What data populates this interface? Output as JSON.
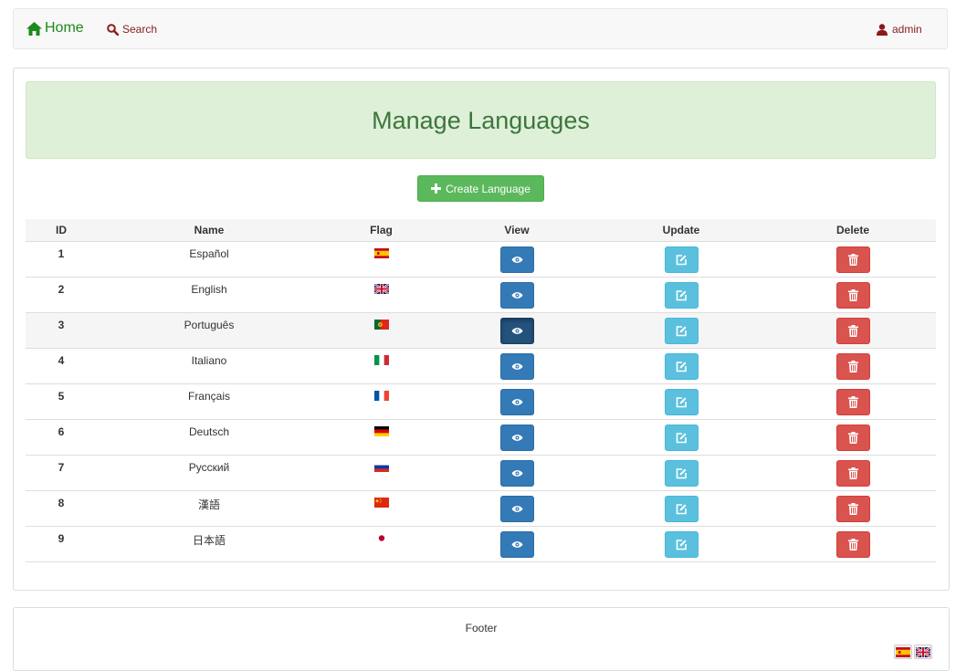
{
  "nav": {
    "home_label": "Home",
    "search_label": "Search",
    "user_label": "admin"
  },
  "page": {
    "title": "Manage Languages",
    "create_label": "Create Language"
  },
  "table": {
    "headers": [
      "ID",
      "Name",
      "Flag",
      "View",
      "Update",
      "Delete"
    ],
    "rows": [
      {
        "id": "1",
        "name": "Español",
        "flag": "es-flag-icon"
      },
      {
        "id": "2",
        "name": "English",
        "flag": "gb-flag-icon"
      },
      {
        "id": "3",
        "name": "Português",
        "flag": "pt-flag-icon"
      },
      {
        "id": "4",
        "name": "Italiano",
        "flag": "it-flag-icon"
      },
      {
        "id": "5",
        "name": "Français",
        "flag": "fr-flag-icon"
      },
      {
        "id": "6",
        "name": "Deutsch",
        "flag": "de-flag-icon"
      },
      {
        "id": "7",
        "name": "Русский",
        "flag": "ru-flag-icon"
      },
      {
        "id": "8",
        "name": "漢語",
        "flag": "cn-flag-icon"
      },
      {
        "id": "9",
        "name": "日本語",
        "flag": "jp-flag-icon"
      }
    ]
  },
  "footer": {
    "text": "Footer",
    "languages": [
      "es-flag-icon",
      "gb-flag-icon"
    ]
  },
  "colors": {
    "success": "#5cb85c",
    "primary": "#337ab7",
    "info": "#5bc0de",
    "danger": "#d9534f",
    "nav_link": "#8b1a1a",
    "home": "#1d8a1d",
    "title": "#3c763d"
  }
}
